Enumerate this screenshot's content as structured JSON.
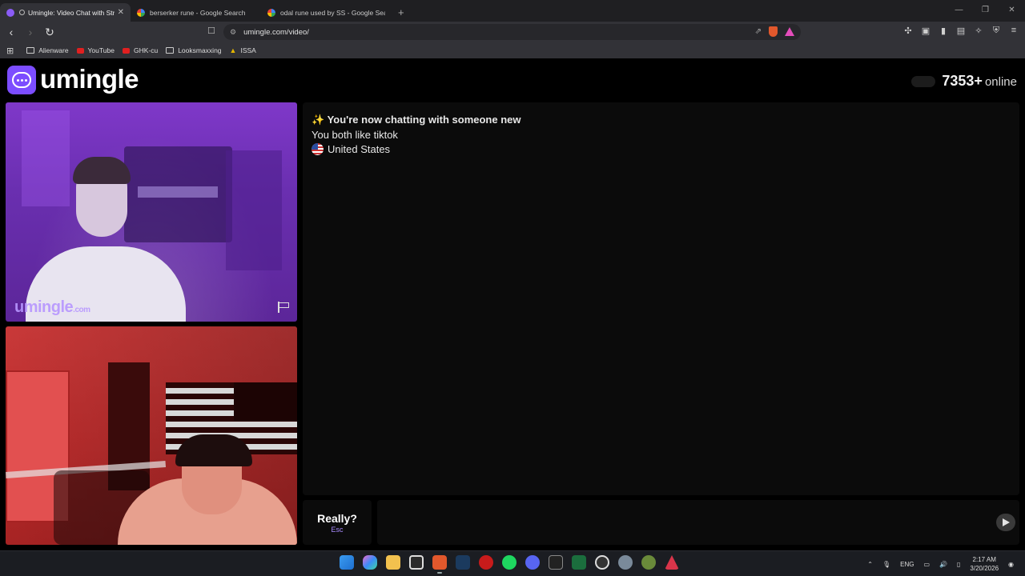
{
  "browser": {
    "tabs": [
      {
        "title": "Umingle: Video Chat with Str",
        "active": true
      },
      {
        "title": "berserker rune - Google Search",
        "active": false
      },
      {
        "title": "odal rune used by SS - Google Search",
        "active": false
      }
    ],
    "new_tab": "+",
    "url": "umingle.com/video/",
    "bookmarks": [
      {
        "label": "Alienware",
        "icon": "folder-icon"
      },
      {
        "label": "YouTube",
        "icon": "youtube-icon"
      },
      {
        "label": "GHK-cu",
        "icon": "youtube-icon"
      },
      {
        "label": "Looksmaxxing",
        "icon": "folder-icon"
      },
      {
        "label": "ISSA",
        "icon": "issa-icon"
      }
    ]
  },
  "site": {
    "logo_text": "umingle",
    "online_count": "7353+",
    "online_word": "online",
    "watermark": "umingle",
    "watermark_suffix": ".com"
  },
  "chat": {
    "header": "✨ You're now chatting with someone new",
    "interest": "You both like tiktok",
    "country": "United States"
  },
  "controls": {
    "next_label": "Really?",
    "next_key": "Esc",
    "message_placeholder": ""
  },
  "taskbar": {
    "language": "ENG",
    "time": "2:17 AM",
    "date": "3/20/2026"
  },
  "colors": {
    "brand": "#7c4dff",
    "remote_video_tint": "#7f38c9",
    "local_video_tint": "#d43c3c"
  }
}
